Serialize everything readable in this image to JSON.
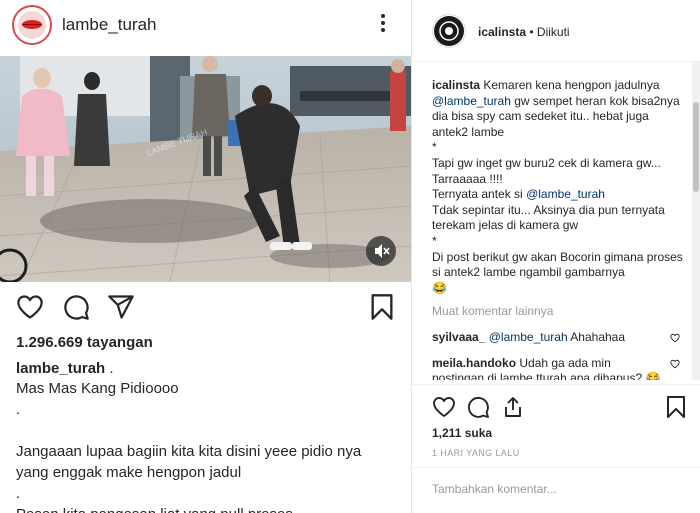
{
  "left_post": {
    "username": "lambe_turah",
    "views": "1.296.669 tayangan",
    "caption_user": "lambe_turah",
    "caption_user_suffix": ".",
    "caption_lines": [
      "Mas Mas Kang Pidioooo",
      ".",
      "",
      "Jangaaan lupaa bagiin kita kita disini yeee pidio nya",
      "yang enggak make hengpon jadul",
      ".",
      "Pesen kita pengesan liat yang pull proses"
    ],
    "video_watermark": "LAMBE TURAH"
  },
  "right_panel": {
    "username": "icalinsta",
    "follow_status": "• Diikuti",
    "caption": {
      "user": "icalinsta",
      "line1": " Kemaren kena hengpon jadulnya",
      "mention1": "@lambe_turah",
      "line2": " gw sempet heran kok bisa2nya dia bisa spy cam sedeket itu.. hebat juga antek2 lambe",
      "star1": "*",
      "line3": "Tapi gw inget gw buru2 cek di kamera gw... Tarraaaaa !!!!",
      "line4a": "Ternyata antek si ",
      "mention2": "@lambe_turah",
      "line5": "Tdak sepintar itu... Aksinya dia pun ternyata terekam jelas di kamera gw",
      "star2": "*",
      "line6": "Di post berikut gw akan Bocorin gimana proses si antek2 lambe ngambil gambarnya",
      "emoji": "😂"
    },
    "more_comments": "Muat komentar lainnya",
    "replies": [
      {
        "user": "syilvaaa_",
        "mention": "@lambe_turah",
        "text": " Ahahahaa"
      },
      {
        "user": "meila.handoko",
        "mention": "",
        "text": " Udah ga ada min postingan di lambe tturah apa dihapus? 😂"
      }
    ],
    "likes": "1,211 suka",
    "time": "1 HARI YANG LALU",
    "add_comment_placeholder": "Tambahkan komentar..."
  },
  "colors": {
    "text": "#262626",
    "muted": "#999999",
    "mention": "#003569",
    "divider": "#e6e6e6",
    "avatar_ring": "#d94a4a"
  },
  "icons": [
    "heart-icon",
    "comment-icon",
    "share-icon",
    "bookmark-icon",
    "more-icon",
    "mute-icon",
    "small-heart-icon",
    "upload-icon"
  ]
}
